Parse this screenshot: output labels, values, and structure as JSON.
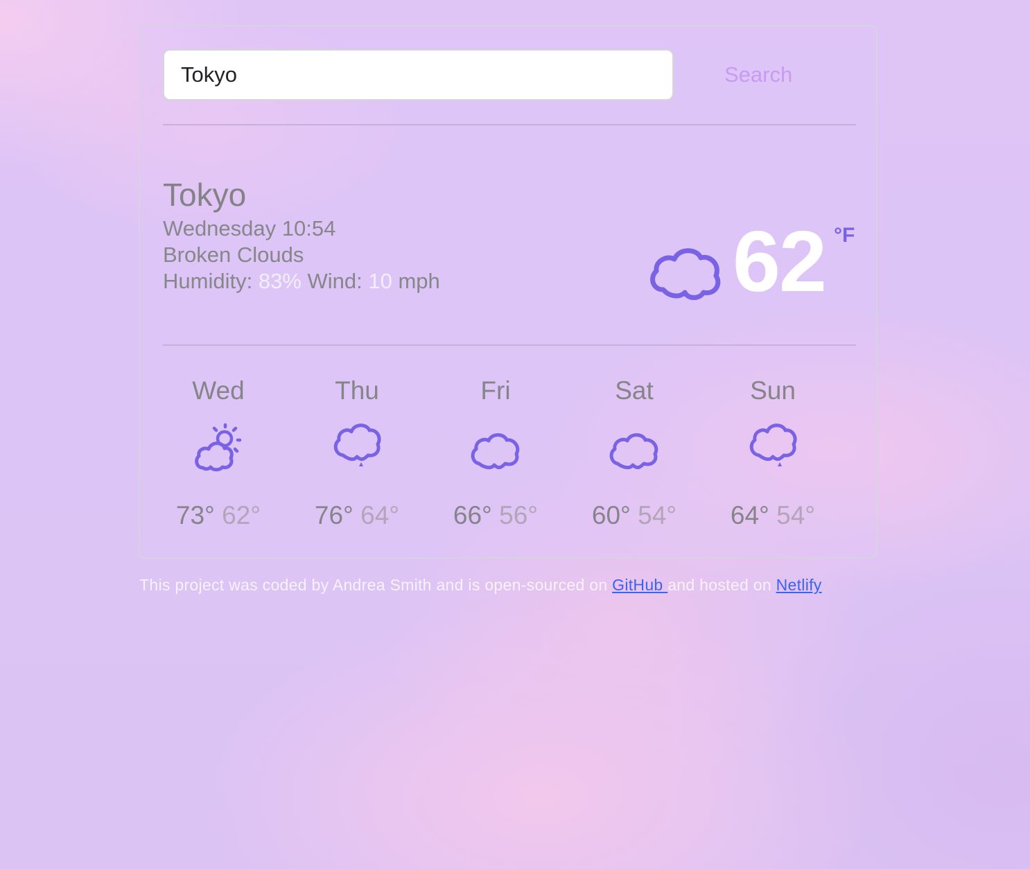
{
  "search": {
    "value": "Tokyo",
    "placeholder": "",
    "button_label": "Search"
  },
  "current": {
    "city": "Tokyo",
    "datetime": "Wednesday 10:54",
    "description": "Broken Clouds",
    "humidity_label": "Humidity:",
    "humidity_value": "83%",
    "wind_label": "Wind:",
    "wind_value": "10",
    "wind_unit": "mph",
    "temperature": "62",
    "unit": "°F",
    "icon": "cloud-icon"
  },
  "forecast": [
    {
      "day": "Wed",
      "icon": "partly-cloudy-icon",
      "max": "73°",
      "min": "62°"
    },
    {
      "day": "Thu",
      "icon": "cloud-rain-icon",
      "max": "76°",
      "min": "64°"
    },
    {
      "day": "Fri",
      "icon": "cloud-icon",
      "max": "66°",
      "min": "56°"
    },
    {
      "day": "Sat",
      "icon": "cloud-icon",
      "max": "60°",
      "min": "54°"
    },
    {
      "day": "Sun",
      "icon": "cloud-rain-icon",
      "max": "64°",
      "min": "54°"
    }
  ],
  "footer": {
    "text_before": "This project was coded by Andrea Smith and is open-sourced on ",
    "github_label": "GitHub ",
    "text_middle": "and hosted on ",
    "netlify_label": "Netlify"
  },
  "colors": {
    "accent": "#7a62e4",
    "search_button": "#c89af2",
    "link": "#3a64ee"
  }
}
